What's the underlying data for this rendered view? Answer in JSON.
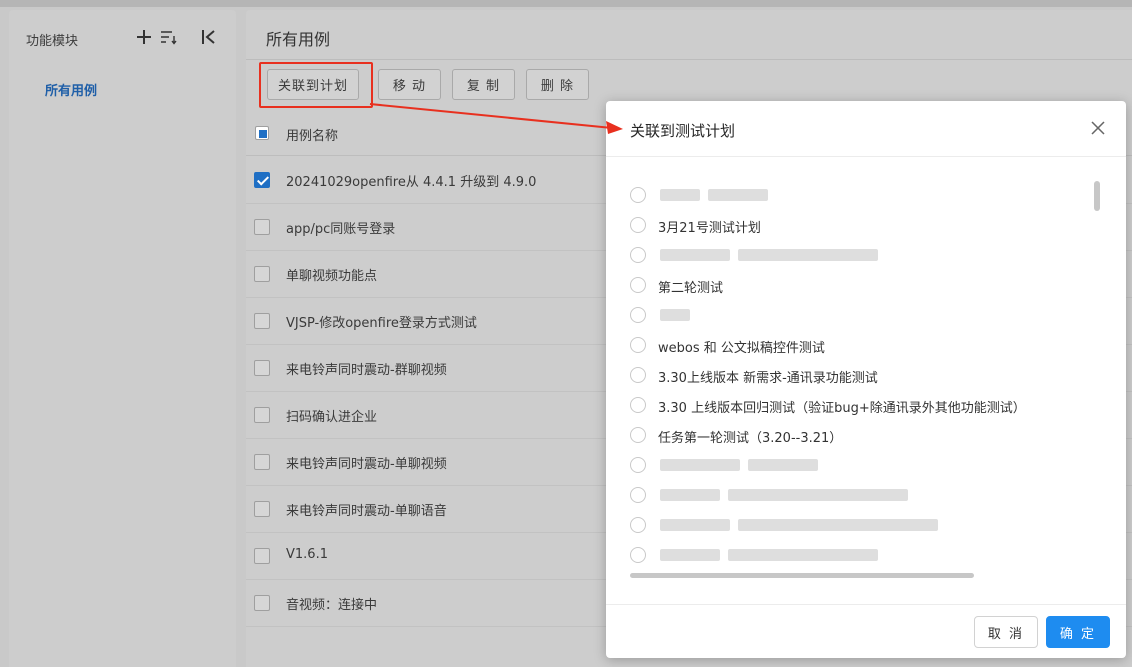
{
  "sidebar": {
    "title": "功能模块",
    "item_all": "所有用例",
    "icons": [
      "plus-icon",
      "sort-icon",
      "collapse-icon"
    ]
  },
  "main": {
    "title": "所有用例",
    "toolbar": {
      "link_plan": "关联到计划",
      "move": "移 动",
      "copy": "复 制",
      "delete": "删 除"
    },
    "table": {
      "header": "用例名称",
      "rows": [
        {
          "name": "20241029openfire从 4.4.1 升级到 4.9.0",
          "checked": true
        },
        {
          "name": "app/pc同账号登录",
          "checked": false
        },
        {
          "name": "单聊视频功能点",
          "checked": false
        },
        {
          "name": "VJSP-修改openfire登录方式测试",
          "checked": false
        },
        {
          "name": "来电铃声同时震动-群聊视频",
          "checked": false
        },
        {
          "name": "扫码确认进企业",
          "checked": false
        },
        {
          "name": "来电铃声同时震动-单聊视频",
          "checked": false
        },
        {
          "name": "来电铃声同时震动-单聊语音",
          "checked": false
        },
        {
          "name": "V1.6.1",
          "checked": false
        },
        {
          "name": "音视频：连接中",
          "checked": false
        }
      ]
    }
  },
  "modal": {
    "title": "关联到测试计划",
    "plans": [
      {
        "label": "",
        "redacted": true
      },
      {
        "label": "3月21号测试计划",
        "redacted": false
      },
      {
        "label": "",
        "redacted": true
      },
      {
        "label": "第二轮测试",
        "redacted": false
      },
      {
        "label": "",
        "redacted": true
      },
      {
        "label": "webos 和 公文拟稿控件测试",
        "redacted": false
      },
      {
        "label": "3.30上线版本 新需求-通讯录功能测试",
        "redacted": false
      },
      {
        "label": "3.30 上线版本回归测试（验证bug+除通讯录外其他功能测试）",
        "redacted": false
      },
      {
        "label": "任务第一轮测试（3.20--3.21）",
        "redacted": false
      },
      {
        "label": "",
        "redacted": true
      },
      {
        "label": "",
        "redacted": true
      },
      {
        "label": "",
        "redacted": true
      },
      {
        "label": "",
        "redacted": true
      }
    ],
    "cancel": "取 消",
    "confirm": "确 定"
  },
  "colors": {
    "accent": "#1e8cf0",
    "highlight": "#e8301f",
    "sidebar_active": "#1f5fa8"
  }
}
